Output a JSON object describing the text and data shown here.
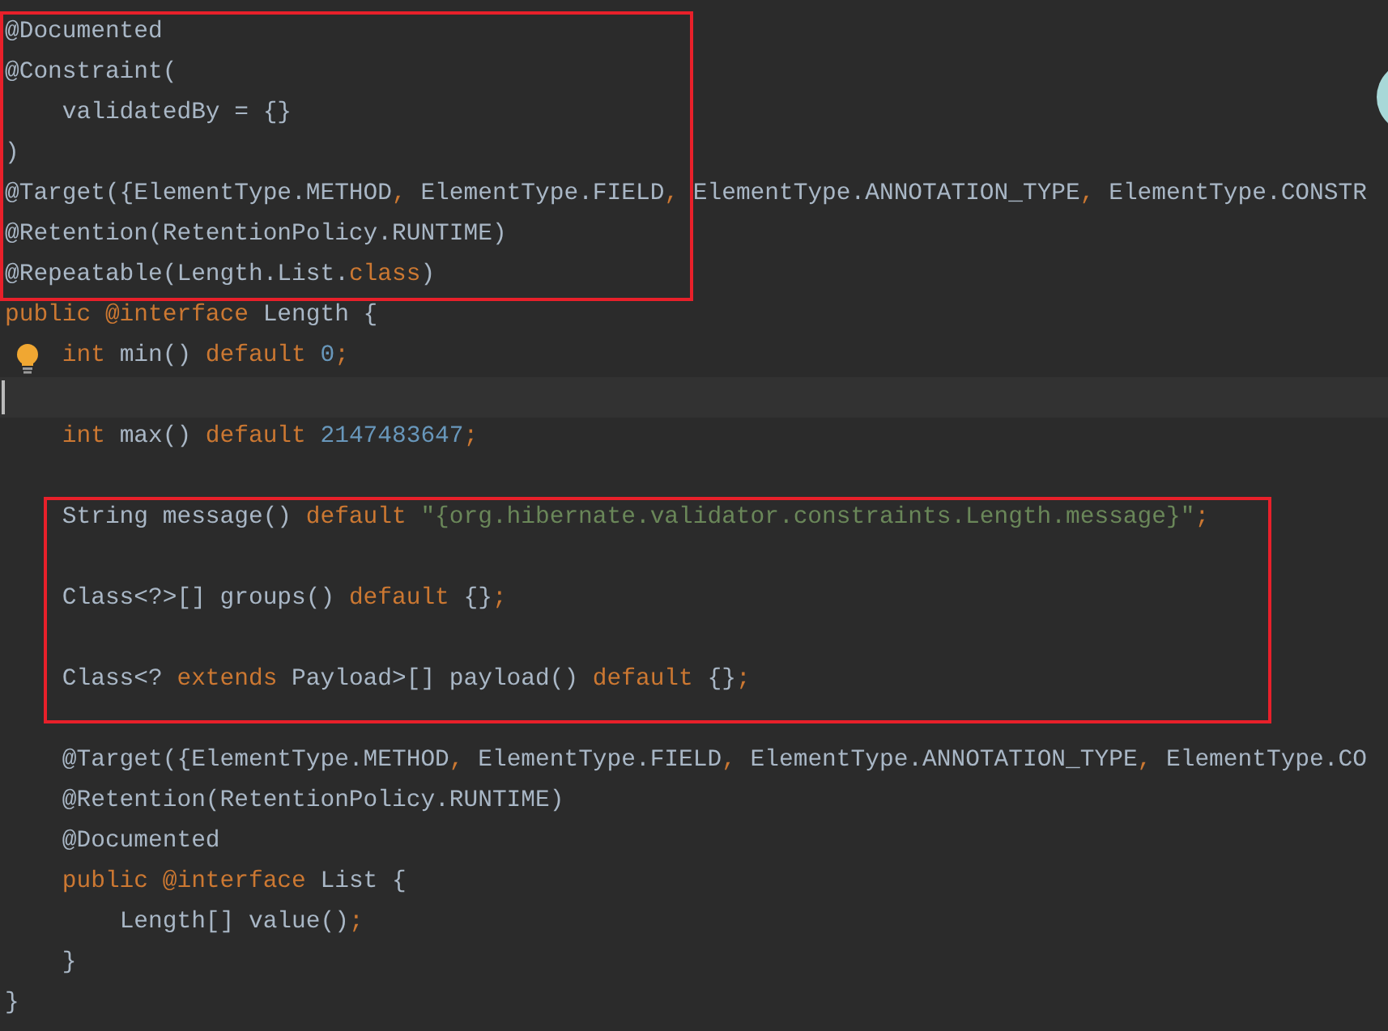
{
  "editor": {
    "blocks": [
      {
        "boxed": true,
        "lines": [
          {
            "kind": "code",
            "tokens": [
              {
                "text": "@Documented",
                "kind": "plain"
              }
            ]
          },
          {
            "kind": "code",
            "tokens": [
              {
                "text": "@Constraint(",
                "kind": "plain"
              }
            ]
          },
          {
            "kind": "code",
            "tokens": [
              {
                "text": "    validatedBy = {}",
                "kind": "plain"
              }
            ]
          },
          {
            "kind": "code",
            "tokens": [
              {
                "text": ")",
                "kind": "plain"
              }
            ]
          },
          {
            "kind": "code",
            "tokens": [
              {
                "text": "@Target({ElementType.METHOD",
                "kind": "plain"
              },
              {
                "text": ",",
                "kind": "keyword"
              },
              {
                "text": " ElementType.FIELD",
                "kind": "plain"
              },
              {
                "text": ",",
                "kind": "keyword"
              },
              {
                "text": " ElementType.ANNOTATION_TYPE",
                "kind": "plain"
              },
              {
                "text": ",",
                "kind": "keyword"
              },
              {
                "text": " ElementType.CONSTR",
                "kind": "plain"
              }
            ]
          },
          {
            "kind": "code",
            "tokens": [
              {
                "text": "@Retention(RetentionPolicy.RUNTIME)",
                "kind": "plain"
              }
            ]
          },
          {
            "kind": "code",
            "tokens": [
              {
                "text": "@Repeatable(Length.List.",
                "kind": "plain"
              },
              {
                "text": "class",
                "kind": "keyword"
              },
              {
                "text": ")",
                "kind": "plain"
              }
            ]
          }
        ]
      },
      {
        "boxed": false,
        "lines": [
          {
            "kind": "code",
            "tokens": [
              {
                "text": "public @interface",
                "kind": "keyword"
              },
              {
                "text": " Length {",
                "kind": "plain"
              }
            ]
          },
          {
            "kind": "code",
            "bulb": true,
            "tokens": [
              {
                "text": "    int",
                "kind": "keyword"
              },
              {
                "text": " min()",
                "kind": "plain"
              },
              {
                "text": " default",
                "kind": "keyword"
              },
              {
                "text": " 0",
                "kind": "number"
              },
              {
                "text": ";",
                "kind": "keyword"
              }
            ]
          },
          {
            "kind": "blank",
            "current": true
          },
          {
            "kind": "code",
            "tokens": [
              {
                "text": "    int",
                "kind": "keyword"
              },
              {
                "text": " max()",
                "kind": "plain"
              },
              {
                "text": " default",
                "kind": "keyword"
              },
              {
                "text": " 2147483647",
                "kind": "number"
              },
              {
                "text": ";",
                "kind": "keyword"
              }
            ]
          },
          {
            "kind": "blank"
          }
        ]
      },
      {
        "boxed": true,
        "lines": [
          {
            "kind": "code",
            "tokens": [
              {
                "text": "    String message()",
                "kind": "plain"
              },
              {
                "text": " default",
                "kind": "keyword"
              },
              {
                "text": " \"{org.hibernate.validator.constraints.Length.message}\"",
                "kind": "string"
              },
              {
                "text": ";",
                "kind": "keyword"
              }
            ]
          },
          {
            "kind": "blank"
          },
          {
            "kind": "code",
            "tokens": [
              {
                "text": "    Class<?>[] groups()",
                "kind": "plain"
              },
              {
                "text": " default",
                "kind": "keyword"
              },
              {
                "text": " {}",
                "kind": "plain"
              },
              {
                "text": ";",
                "kind": "keyword"
              }
            ]
          },
          {
            "kind": "blank"
          },
          {
            "kind": "code",
            "tokens": [
              {
                "text": "    Class<?",
                "kind": "plain"
              },
              {
                "text": " extends",
                "kind": "keyword"
              },
              {
                "text": " Payload>[] payload()",
                "kind": "plain"
              },
              {
                "text": " default",
                "kind": "keyword"
              },
              {
                "text": " {}",
                "kind": "plain"
              },
              {
                "text": ";",
                "kind": "keyword"
              }
            ]
          }
        ]
      },
      {
        "boxed": false,
        "lines": [
          {
            "kind": "blank"
          },
          {
            "kind": "code",
            "tokens": [
              {
                "text": "    @Target({ElementType.METHOD",
                "kind": "plain"
              },
              {
                "text": ",",
                "kind": "keyword"
              },
              {
                "text": " ElementType.FIELD",
                "kind": "plain"
              },
              {
                "text": ",",
                "kind": "keyword"
              },
              {
                "text": " ElementType.ANNOTATION_TYPE",
                "kind": "plain"
              },
              {
                "text": ",",
                "kind": "keyword"
              },
              {
                "text": " ElementType.CO",
                "kind": "plain"
              }
            ]
          },
          {
            "kind": "code",
            "tokens": [
              {
                "text": "    @Retention(RetentionPolicy.RUNTIME)",
                "kind": "plain"
              }
            ]
          },
          {
            "kind": "code",
            "tokens": [
              {
                "text": "    @Documented",
                "kind": "plain"
              }
            ]
          },
          {
            "kind": "code",
            "tokens": [
              {
                "text": "    public @interface",
                "kind": "keyword"
              },
              {
                "text": " List {",
                "kind": "plain"
              }
            ]
          },
          {
            "kind": "code",
            "tokens": [
              {
                "text": "        Length[] value()",
                "kind": "plain"
              },
              {
                "text": ";",
                "kind": "keyword"
              }
            ]
          },
          {
            "kind": "code",
            "tokens": [
              {
                "text": "    }",
                "kind": "plain"
              }
            ]
          },
          {
            "kind": "code",
            "tokens": [
              {
                "text": "}",
                "kind": "plain"
              }
            ]
          }
        ]
      }
    ]
  }
}
